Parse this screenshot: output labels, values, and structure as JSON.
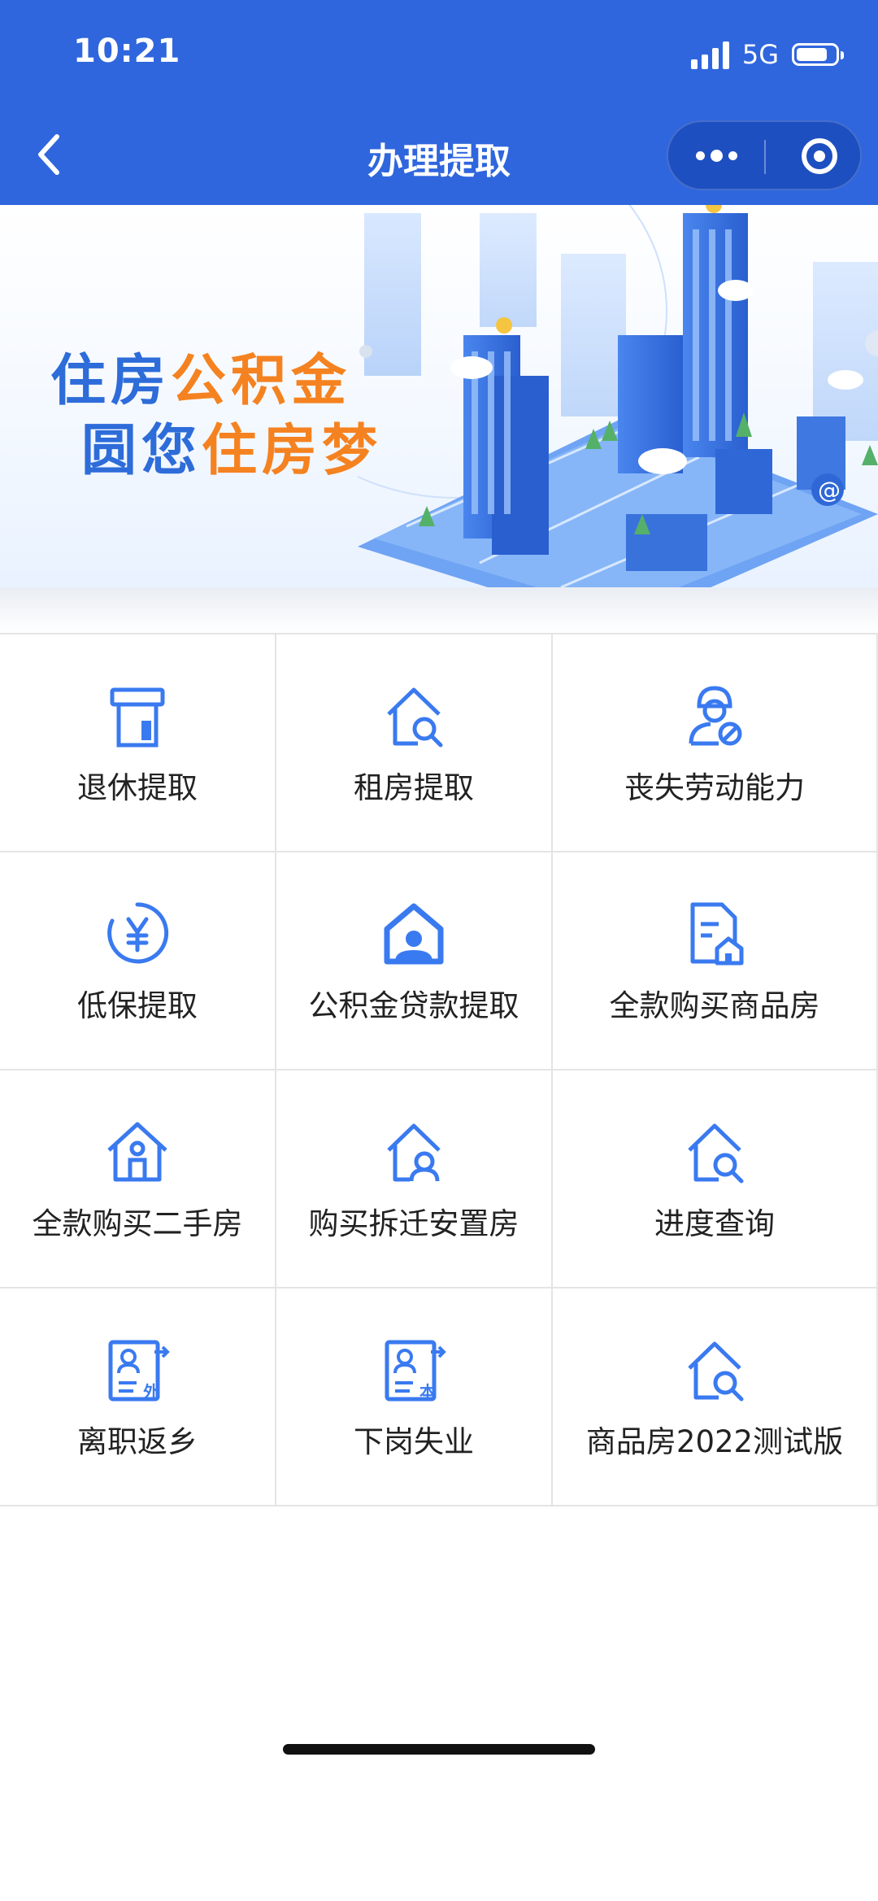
{
  "status_bar": {
    "time": "10:21",
    "network": "5G",
    "battery_level": 0.8
  },
  "nav": {
    "title": "办理提取"
  },
  "banner": {
    "line1": [
      {
        "text": "住房",
        "tone": "blue"
      },
      {
        "text": "公积金",
        "tone": "orange"
      }
    ],
    "line2": [
      {
        "text": "圆您",
        "tone": "blue"
      },
      {
        "text": "住房梦",
        "tone": "orange"
      }
    ]
  },
  "colors": {
    "header": "#2f66dd",
    "accent": "#3a7af0",
    "slogan_blue": "#2d6cd9",
    "slogan_orange": "#f58220"
  },
  "services": [
    {
      "label": "退休提取",
      "icon": "atm-card-icon"
    },
    {
      "label": "租房提取",
      "icon": "house-search-icon"
    },
    {
      "label": "丧失劳动能力",
      "icon": "worker-disabled-icon"
    },
    {
      "label": "低保提取",
      "icon": "yuan-circle-icon"
    },
    {
      "label": "公积金贷款提取",
      "icon": "house-person-icon"
    },
    {
      "label": "全款购买商品房",
      "icon": "document-house-icon"
    },
    {
      "label": "全款购买二手房",
      "icon": "house-door-icon"
    },
    {
      "label": "购买拆迁安置房",
      "icon": "house-user-icon"
    },
    {
      "label": "进度查询",
      "icon": "house-search-icon"
    },
    {
      "label": "离职返乡",
      "icon": "card-outside-icon"
    },
    {
      "label": "下岗失业",
      "icon": "card-local-icon"
    },
    {
      "label": "商品房2022测试版",
      "icon": "house-search-icon"
    }
  ]
}
